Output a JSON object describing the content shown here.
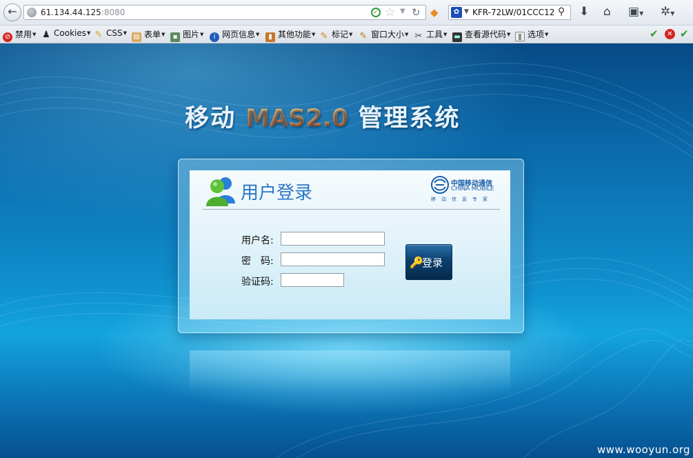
{
  "browser": {
    "url_host": "61.134.44.125",
    "url_port": ":8080",
    "search_value": "KFR-72LW/01CCC12"
  },
  "toolbar": {
    "items": [
      {
        "label": "禁用",
        "icon": "disable-icon"
      },
      {
        "label": "Cookies",
        "icon": "cookie-person-icon"
      },
      {
        "label": "CSS",
        "icon": "pencil-icon"
      },
      {
        "label": "表单",
        "icon": "clipboard-icon"
      },
      {
        "label": "图片",
        "icon": "image-icon"
      },
      {
        "label": "网页信息",
        "icon": "info-icon"
      },
      {
        "label": "其他功能",
        "icon": "book-icon"
      },
      {
        "label": "标记",
        "icon": "marker-icon"
      },
      {
        "label": "窗口大小",
        "icon": "ruler-icon"
      },
      {
        "label": "工具",
        "icon": "tools-icon"
      },
      {
        "label": "查看源代码",
        "icon": "terminal-icon"
      },
      {
        "label": "选项",
        "icon": "options-icon"
      }
    ]
  },
  "page": {
    "title_prefix": "移动",
    "title_mas": "MAS2.0",
    "title_suffix": "管理系统",
    "login_title": "用户登录",
    "logo_cn": "中国移动通信",
    "logo_en": "CHINA MOBILE",
    "logo_tag": "移动信息专家",
    "username_label": "用户名:",
    "password_label": "密　码:",
    "captcha_label": "验证码:",
    "login_button": "登录",
    "watermark": "www.wooyun.org"
  },
  "colors": {
    "background": "#0f8bc9",
    "title_accent": "#ff8a2b",
    "login_title": "#2a77c6",
    "button": "#0b3f6e"
  }
}
